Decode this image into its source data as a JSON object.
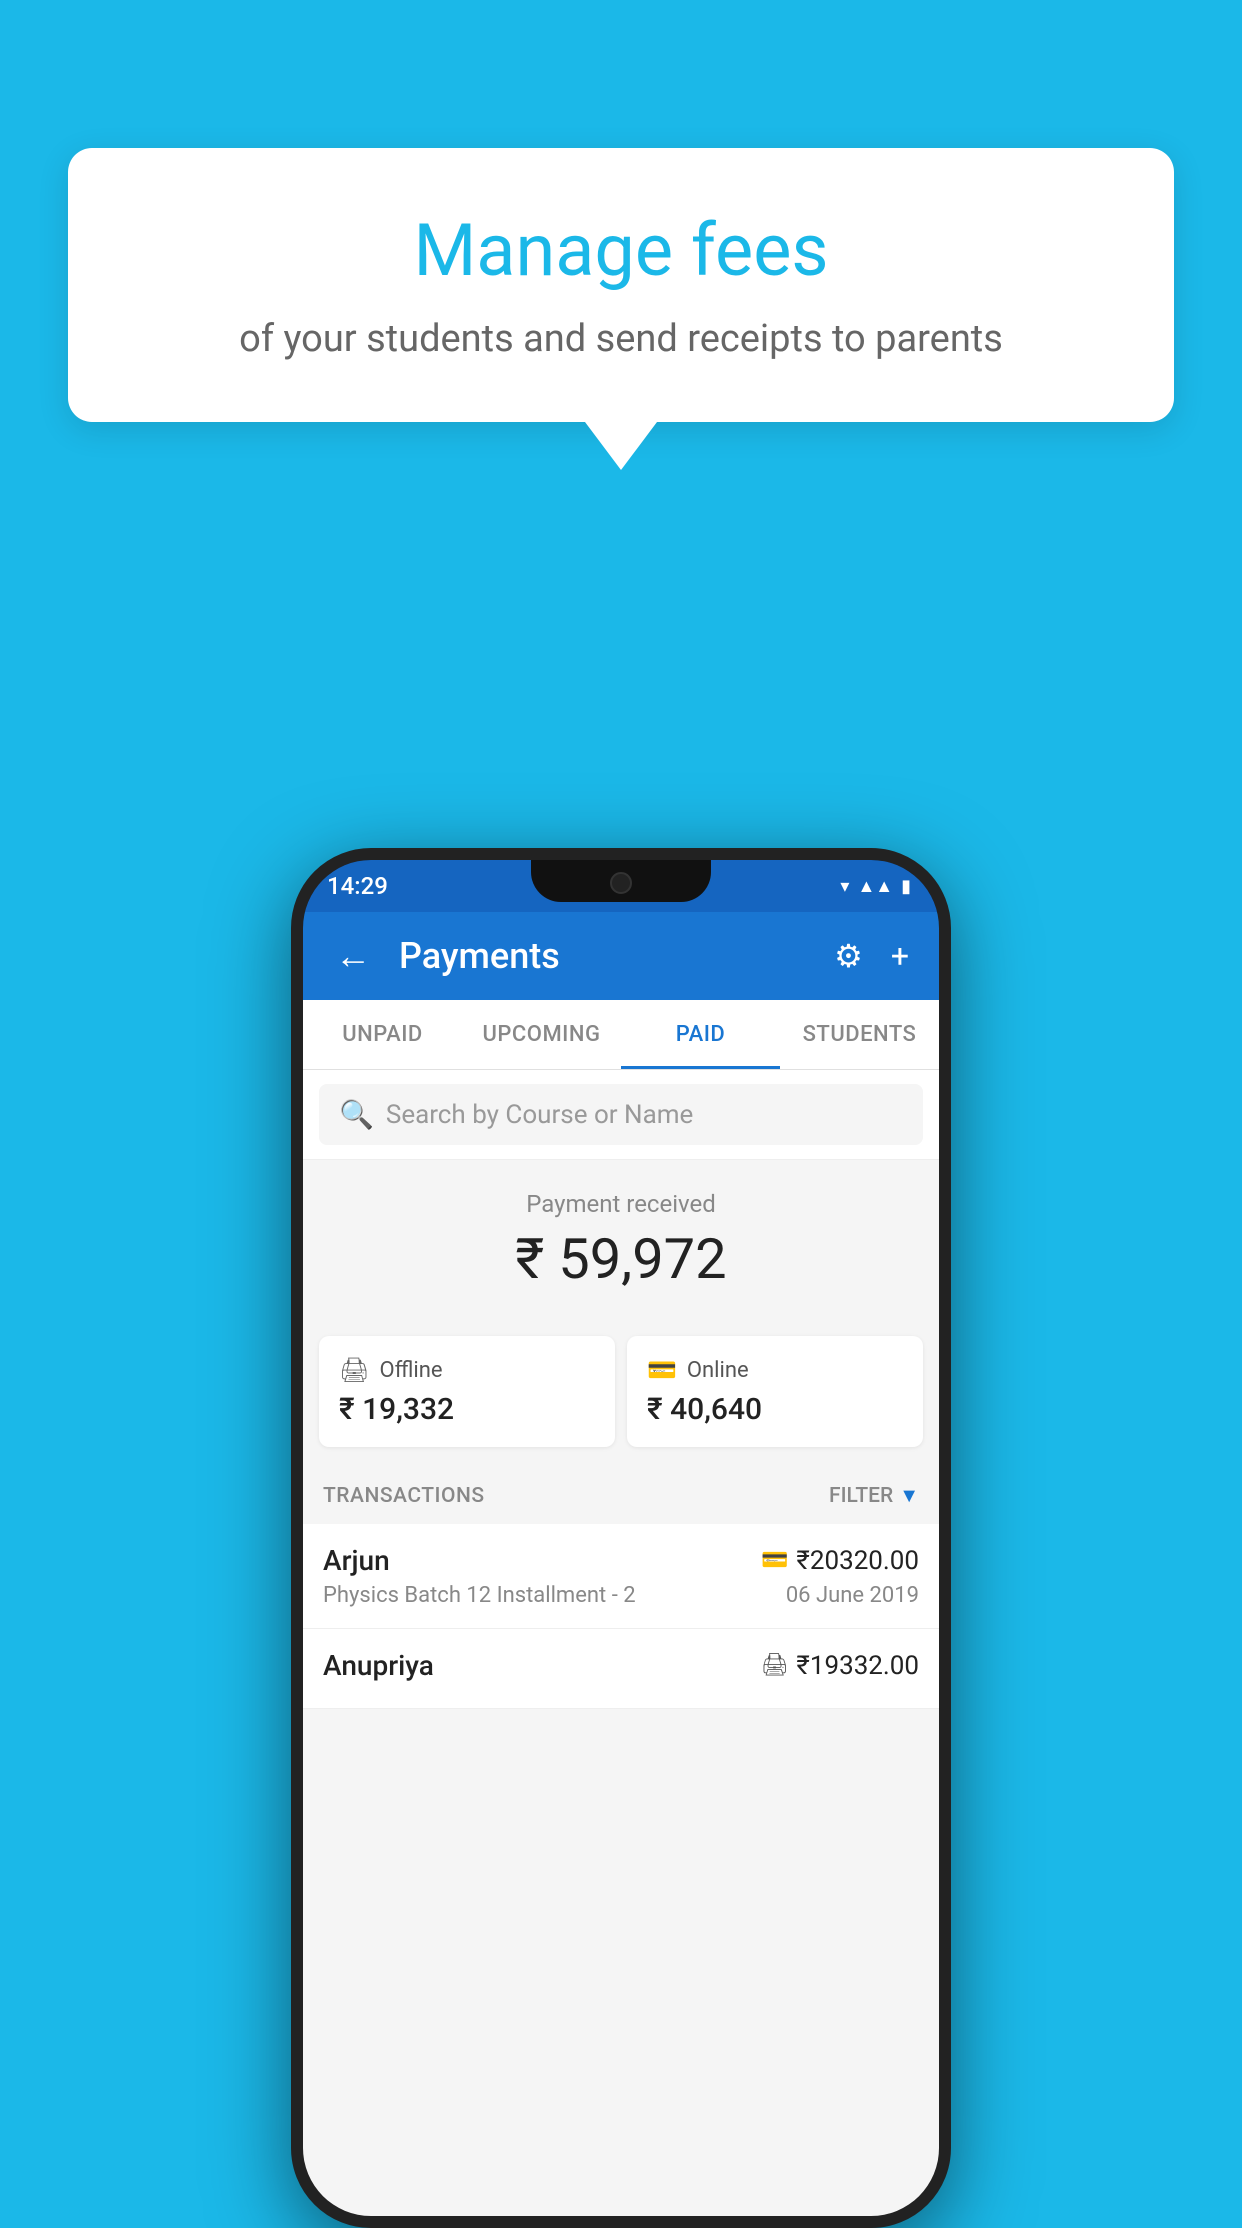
{
  "background_color": "#1BB8E8",
  "bubble": {
    "title": "Manage fees",
    "subtitle": "of your students and send receipts to parents"
  },
  "phone": {
    "status_bar": {
      "time": "14:29"
    },
    "app_bar": {
      "title": "Payments",
      "back_label": "←",
      "settings_label": "⚙",
      "add_label": "+"
    },
    "tabs": [
      {
        "label": "UNPAID",
        "active": false
      },
      {
        "label": "UPCOMING",
        "active": false
      },
      {
        "label": "PAID",
        "active": true
      },
      {
        "label": "STUDENTS",
        "active": false
      }
    ],
    "search": {
      "placeholder": "Search by Course or Name"
    },
    "payment_received": {
      "label": "Payment received",
      "amount": "₹ 59,972",
      "offline": {
        "label": "Offline",
        "amount": "₹ 19,332"
      },
      "online": {
        "label": "Online",
        "amount": "₹ 40,640"
      }
    },
    "transactions": {
      "header_label": "TRANSACTIONS",
      "filter_label": "FILTER",
      "rows": [
        {
          "name": "Arjun",
          "amount": "₹20320.00",
          "payment_type": "card",
          "course": "Physics Batch 12 Installment - 2",
          "date": "06 June 2019"
        },
        {
          "name": "Anupriya",
          "amount": "₹19332.00",
          "payment_type": "rupee",
          "course": "",
          "date": ""
        }
      ]
    }
  }
}
